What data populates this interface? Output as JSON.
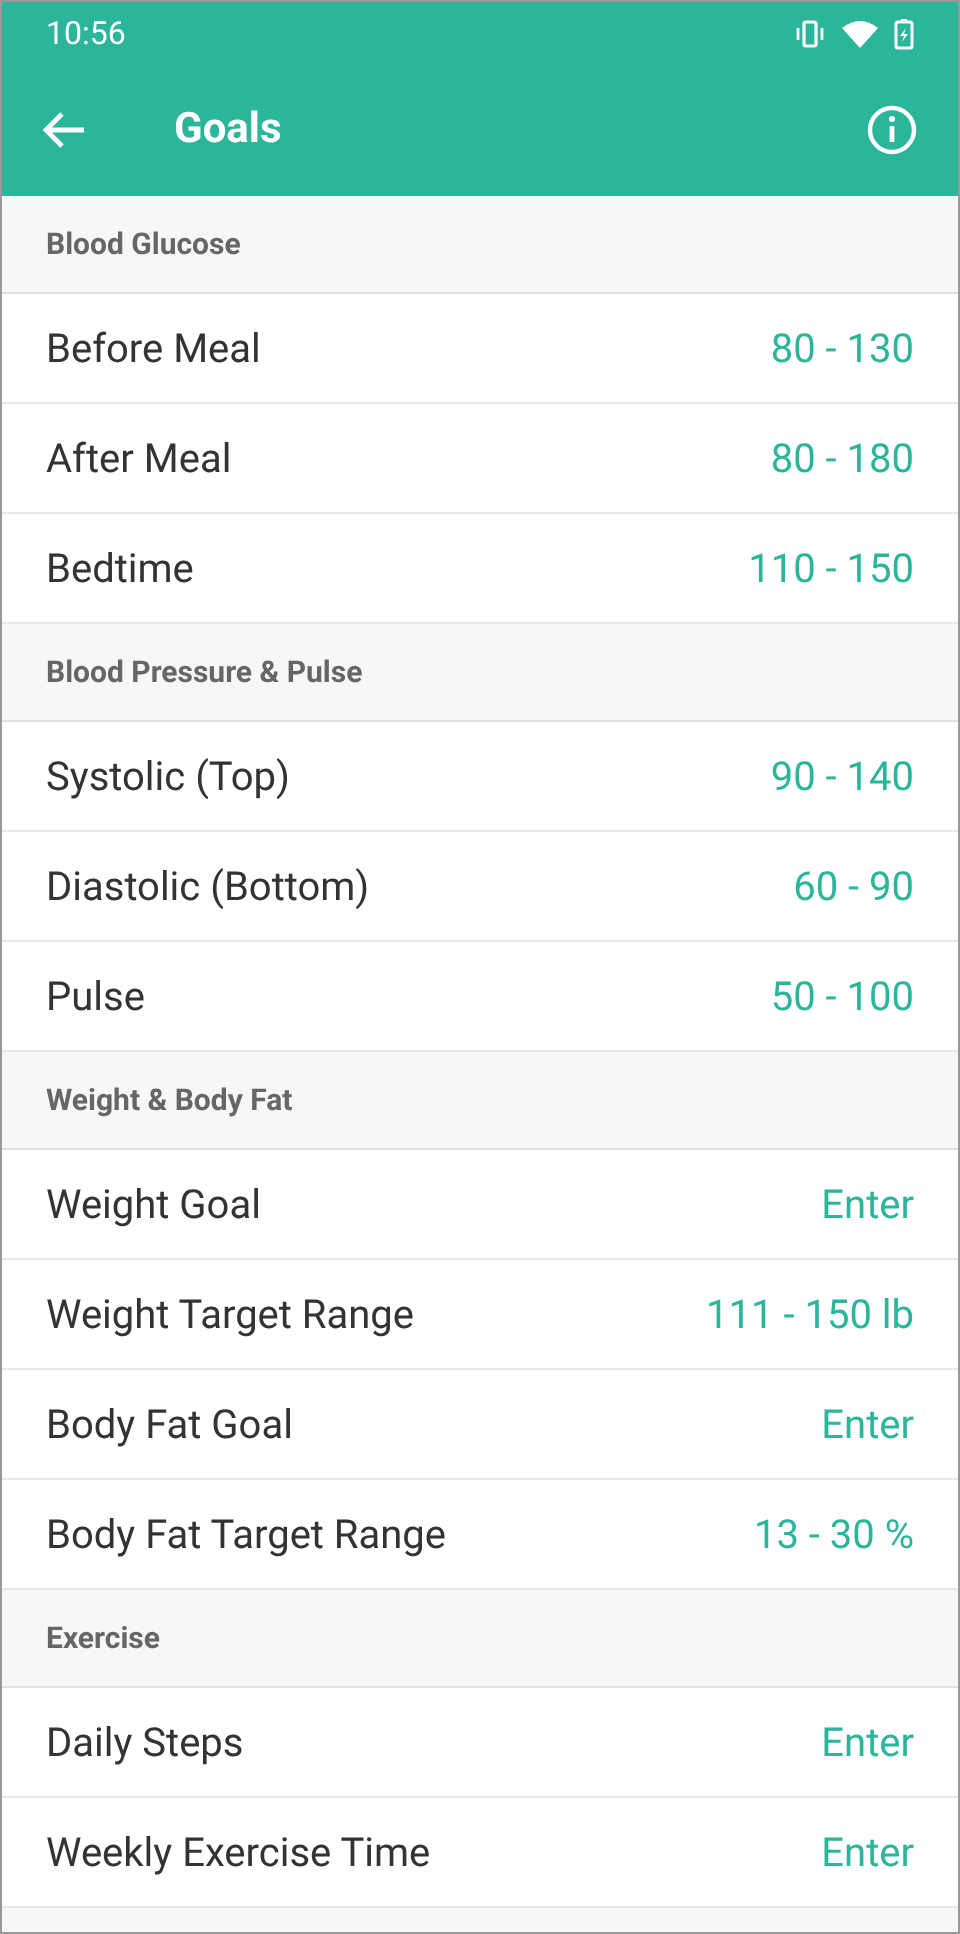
{
  "status_bar": {
    "time": "10:56"
  },
  "toolbar": {
    "title": "Goals"
  },
  "sections": [
    {
      "title": "Blood Glucose",
      "rows": [
        {
          "label": "Before Meal",
          "value": "80 - 130"
        },
        {
          "label": "After Meal",
          "value": "80 - 180"
        },
        {
          "label": "Bedtime",
          "value": "110 - 150"
        }
      ]
    },
    {
      "title": "Blood Pressure & Pulse",
      "rows": [
        {
          "label": "Systolic (Top)",
          "value": "90 - 140"
        },
        {
          "label": "Diastolic (Bottom)",
          "value": "60 - 90"
        },
        {
          "label": "Pulse",
          "value": "50 - 100"
        }
      ]
    },
    {
      "title": "Weight & Body Fat",
      "rows": [
        {
          "label": "Weight Goal",
          "value": "Enter"
        },
        {
          "label": "Weight Target Range",
          "value": "111 - 150 lb"
        },
        {
          "label": "Body Fat Goal",
          "value": "Enter"
        },
        {
          "label": "Body Fat Target Range",
          "value": "13 - 30 %"
        }
      ]
    },
    {
      "title": "Exercise",
      "rows": [
        {
          "label": "Daily Steps",
          "value": "Enter"
        },
        {
          "label": "Weekly Exercise Time",
          "value": "Enter"
        }
      ]
    }
  ]
}
